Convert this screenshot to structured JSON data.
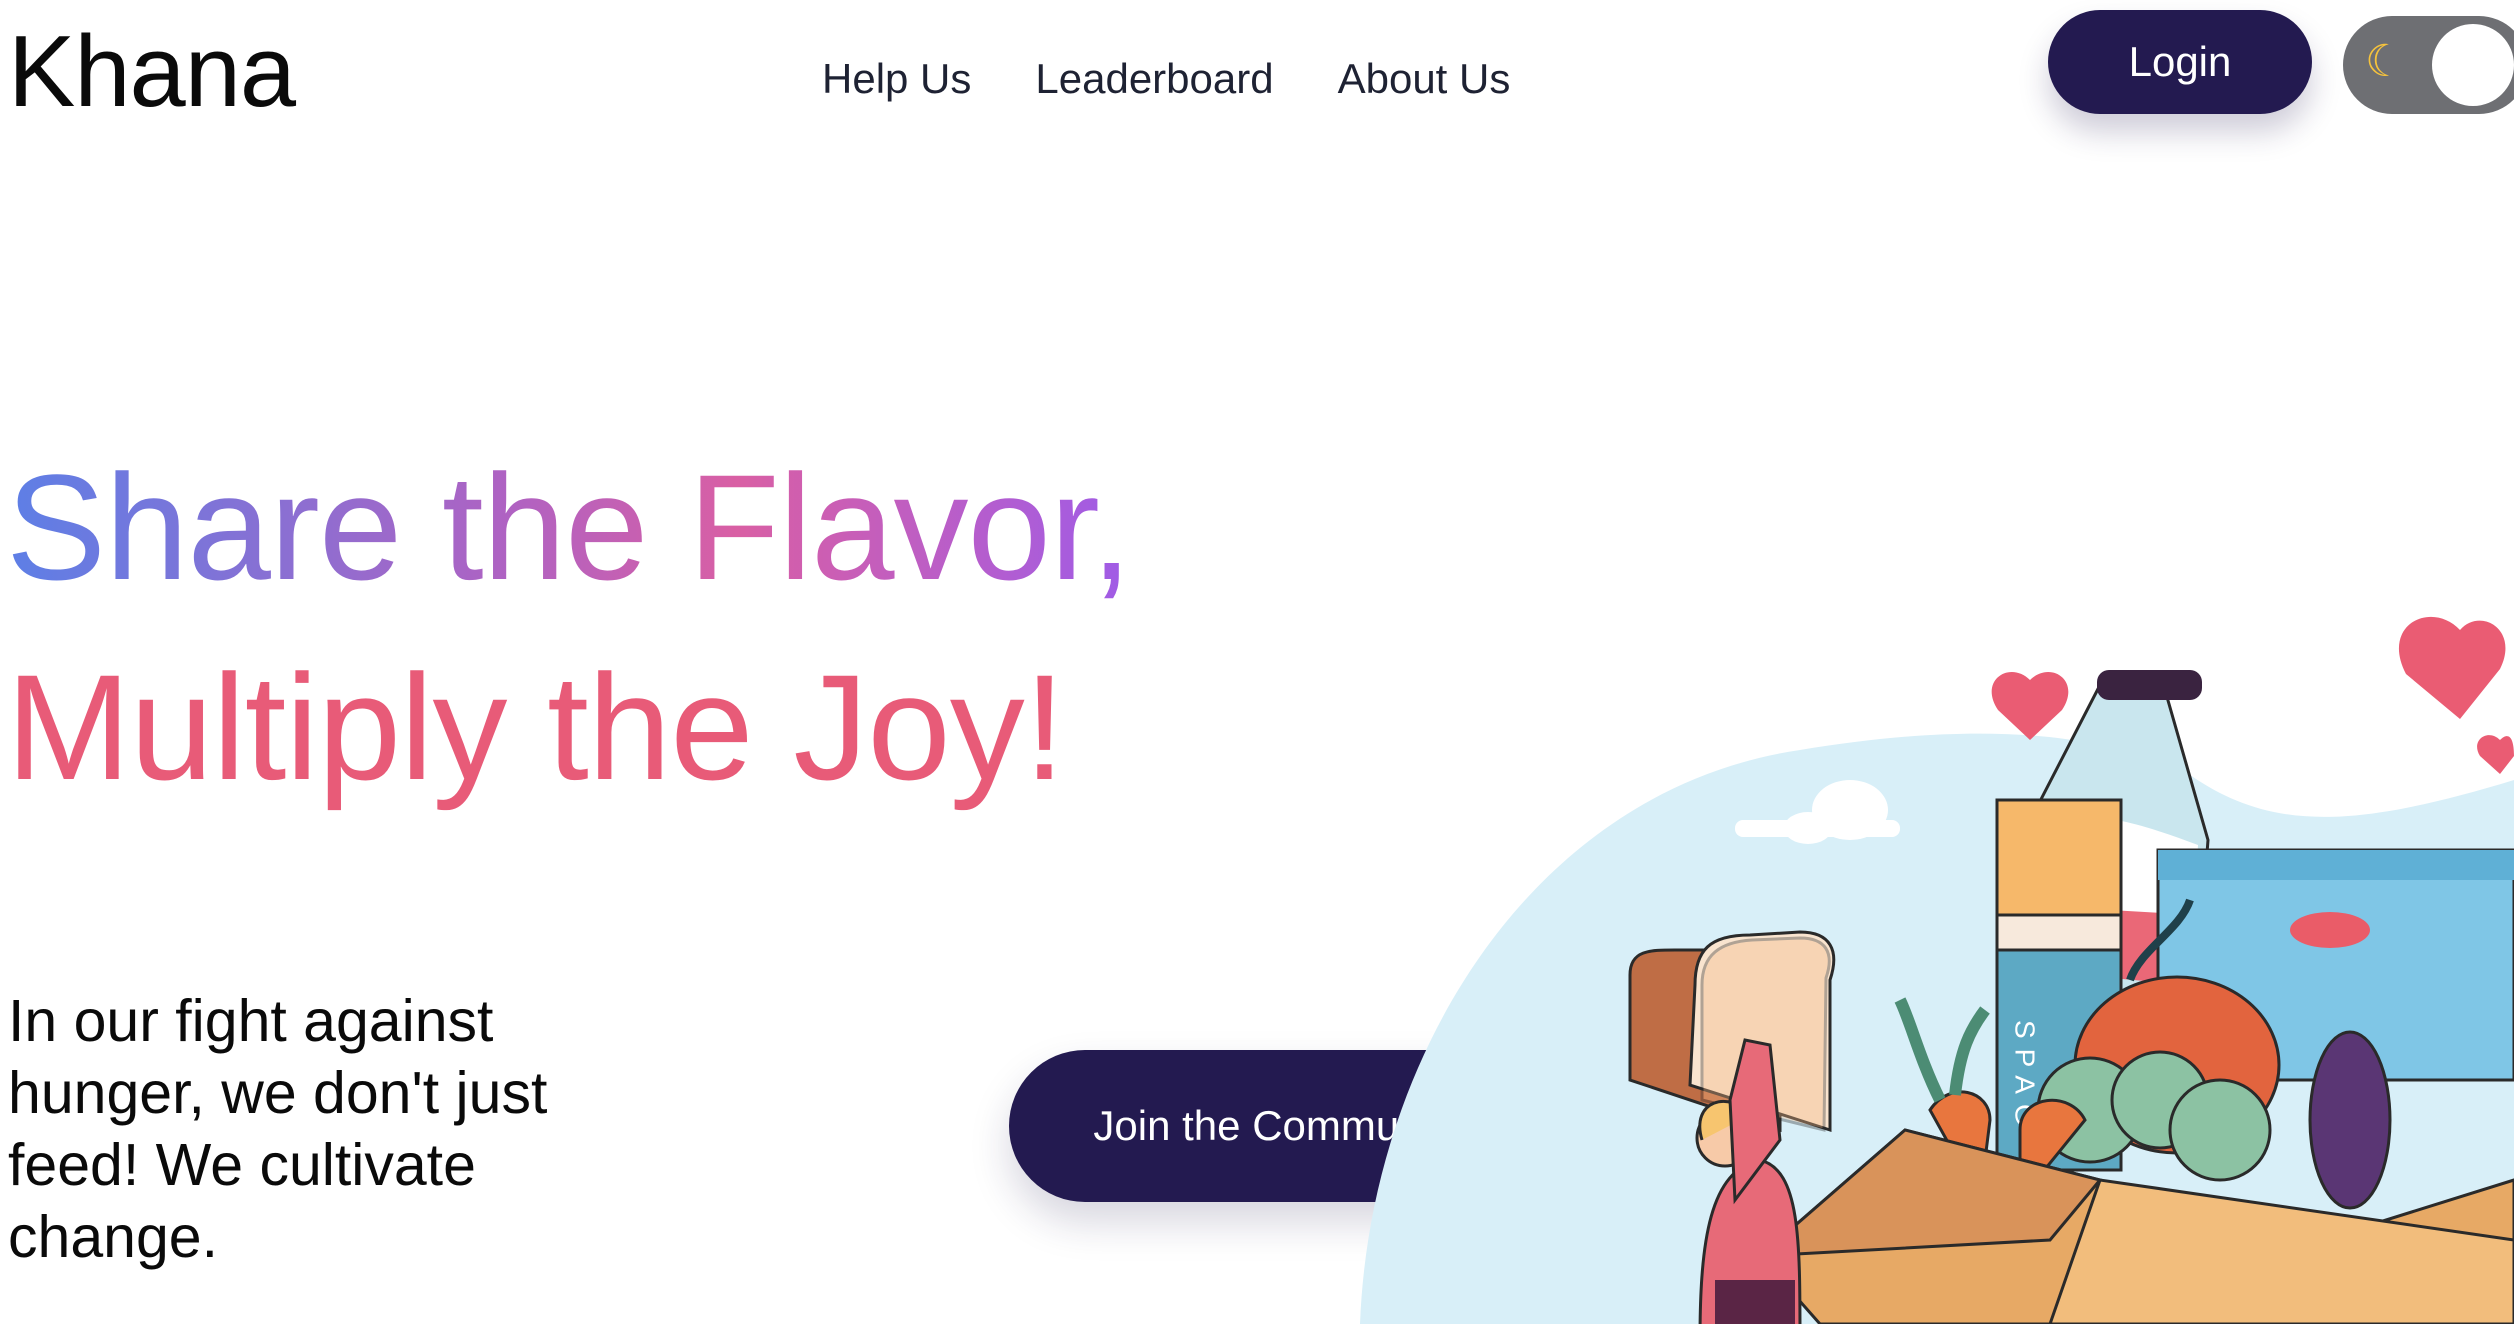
{
  "header": {
    "logo": "Khana",
    "nav": [
      {
        "label": "Help Us"
      },
      {
        "label": "Leaderboard"
      },
      {
        "label": "About Us"
      }
    ],
    "login_label": "Login",
    "theme_toggle": {
      "icon": "moon-icon",
      "state": "light"
    }
  },
  "hero": {
    "title_line1": "Share the Flavor,",
    "title_line2": "Multiply the Joy!",
    "subtitle": "In our fight against hunger, we don't just feed! We cultivate change.",
    "cta_label": "Join the Community",
    "illustration_label": "SPAG"
  },
  "colors": {
    "brand_dark": "#231a50",
    "title_gradient": [
      "#5d7fe6",
      "#d95fa4",
      "#9f5ce7"
    ],
    "title_line2": "#e85b78"
  }
}
